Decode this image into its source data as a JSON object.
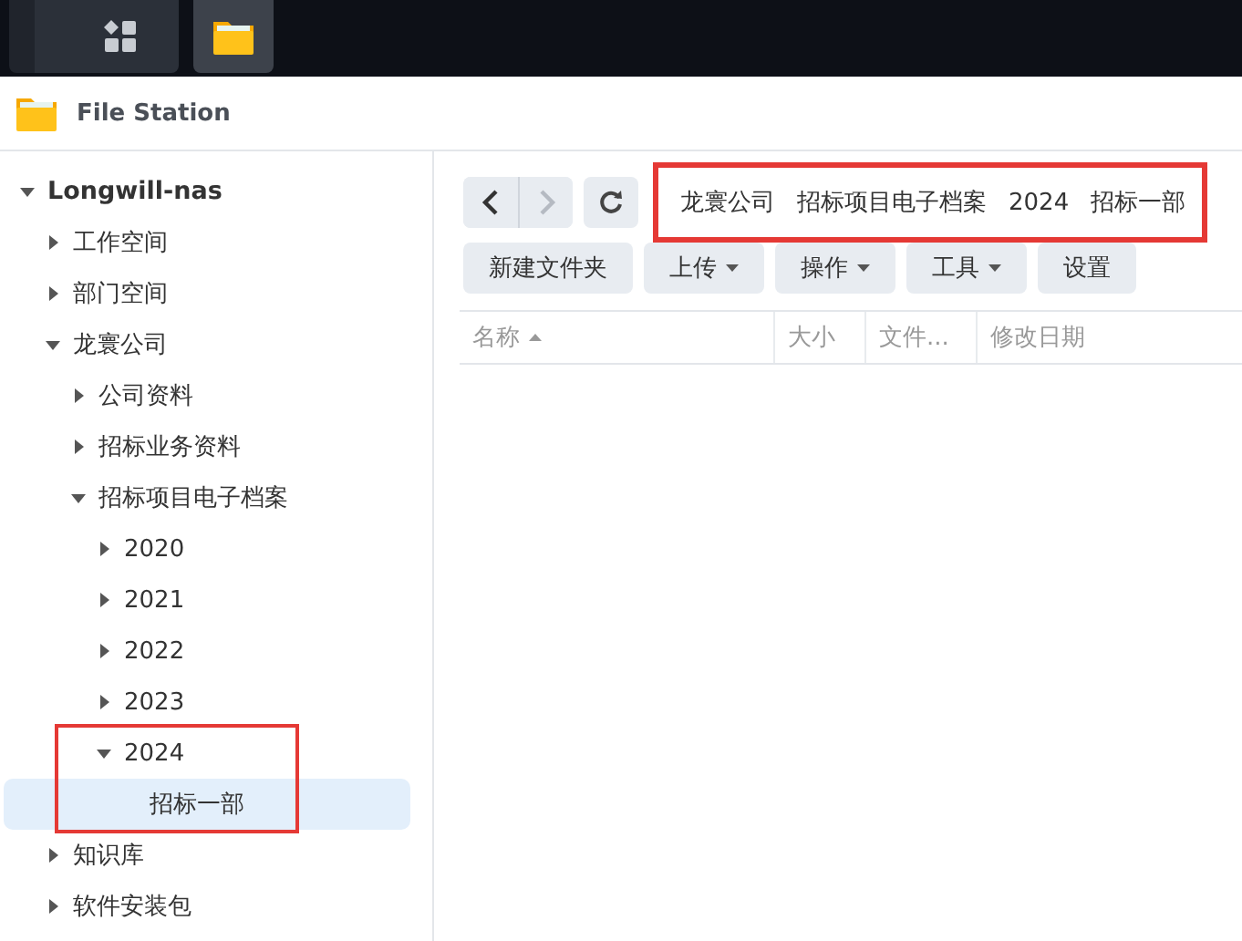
{
  "taskbar": {
    "apps": [
      {
        "kind": "grid",
        "selected": false
      },
      {
        "kind": "folder",
        "selected": true
      }
    ]
  },
  "window": {
    "title": "File Station"
  },
  "tree": [
    {
      "label": "Longwill-nas",
      "expanded": true,
      "selected": false,
      "children": [
        {
          "label": "工作空间",
          "expanded": false,
          "selected": false
        },
        {
          "label": "部门空间",
          "expanded": false,
          "selected": false
        },
        {
          "label": "龙寰公司",
          "expanded": true,
          "selected": false,
          "children": [
            {
              "label": "公司资料",
              "expanded": false,
              "selected": false
            },
            {
              "label": "招标业务资料",
              "expanded": false,
              "selected": false
            },
            {
              "label": "招标项目电子档案",
              "expanded": true,
              "selected": false,
              "children": [
                {
                  "label": "2020",
                  "expanded": false,
                  "selected": false
                },
                {
                  "label": "2021",
                  "expanded": false,
                  "selected": false
                },
                {
                  "label": "2022",
                  "expanded": false,
                  "selected": false
                },
                {
                  "label": "2023",
                  "expanded": false,
                  "selected": false
                },
                {
                  "label": "2024",
                  "expanded": true,
                  "selected": false,
                  "highlighted": true,
                  "children": [
                    {
                      "label": "招标一部",
                      "selected": true
                    }
                  ]
                }
              ]
            }
          ]
        },
        {
          "label": "知识库",
          "expanded": false,
          "selected": false
        },
        {
          "label": "软件安装包",
          "expanded": false,
          "selected": false
        }
      ]
    }
  ],
  "navigation": {
    "back_disabled": false,
    "forward_disabled": true
  },
  "breadcrumb": {
    "highlighted": true,
    "parts": [
      "龙寰公司",
      "招标项目电子档案",
      "2024",
      "招标一部"
    ]
  },
  "toolbar": [
    {
      "label": "新建文件夹"
    },
    {
      "label": "上传",
      "dropdown": true
    },
    {
      "label": "操作",
      "dropdown": true
    },
    {
      "label": "工具",
      "dropdown": true
    },
    {
      "label": "设置"
    }
  ],
  "table": {
    "columns": [
      {
        "label": "名称",
        "sorted": true
      },
      {
        "label": "大小",
        "sorted": false
      },
      {
        "label": "文件...",
        "sorted": false
      },
      {
        "label": "修改日期",
        "sorted": false
      }
    ]
  }
}
